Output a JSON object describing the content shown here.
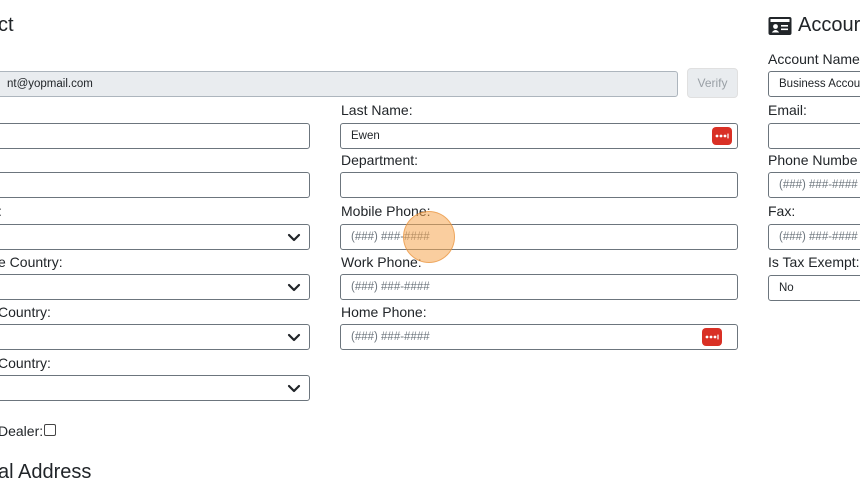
{
  "contact": {
    "title": "ct",
    "email_value": "nt@yopmail.com",
    "verify_label": "Verify",
    "last_name_label": "Last Name:",
    "last_name_value": "Ewen",
    "department_label": "Department:",
    "mobile_phone_label": "Mobile Phone:",
    "mobile_phone_placeholder": "(###) ###-####",
    "work_phone_label": "Work Phone:",
    "work_phone_placeholder": "(###) ###-####",
    "home_phone_label": "Home Phone:",
    "home_phone_placeholder": "(###) ###-####",
    "select3_label": ":",
    "select4_label": "e Country:",
    "select5_label": "Country:",
    "select6_label": " Country:",
    "dealer_label": "Dealer:",
    "section_title": "al Address"
  },
  "account": {
    "title": "Accour",
    "name_label": "Account Name",
    "name_value": "Business Accou",
    "email_label": "Email:",
    "phone_label": "Phone Numbe",
    "phone_placeholder": "(###) ###-####",
    "fax_label": "Fax:",
    "fax_placeholder": "(###) ###-####",
    "tax_label": "Is Tax Exempt:",
    "tax_value": "No"
  },
  "icons": {
    "password_manager": "password-manager-icon",
    "chevron": "chevron-down-icon",
    "account_card": "id-card-icon"
  },
  "colors": {
    "password_manager_badge": "#d93025",
    "cursor_highlight": "#f5a650"
  }
}
